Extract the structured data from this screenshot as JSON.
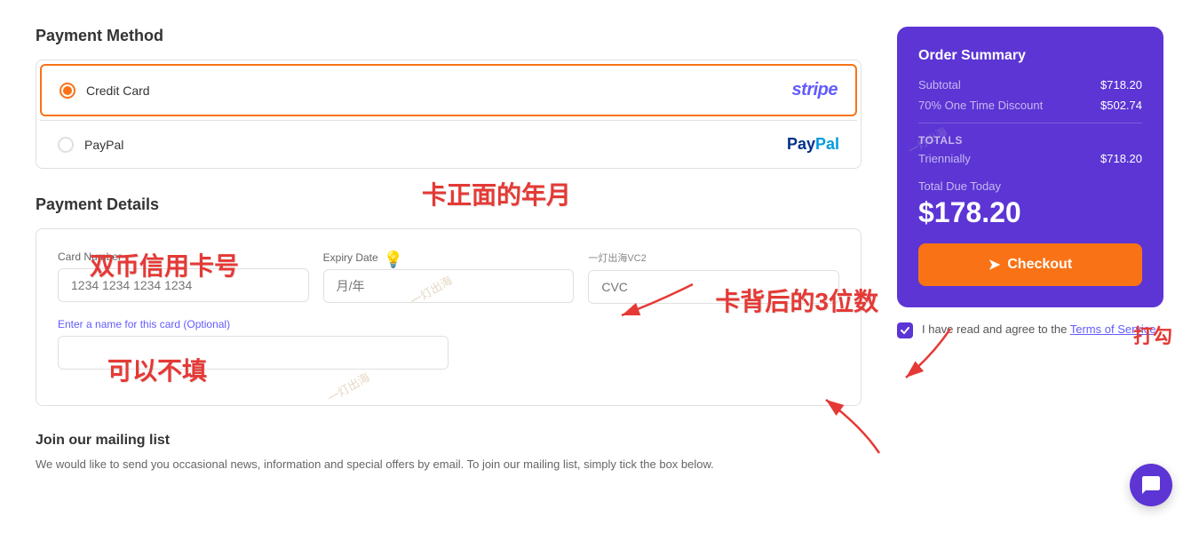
{
  "page": {
    "payment_method": {
      "title": "Payment Method",
      "options": [
        {
          "id": "credit-card",
          "label": "Credit Card",
          "selected": true,
          "logo": "stripe"
        },
        {
          "id": "paypal",
          "label": "PayPal",
          "selected": false,
          "logo": "paypal"
        }
      ]
    },
    "payment_details": {
      "title": "Payment Details",
      "fields": {
        "card_number": {
          "label": "Card Number",
          "placeholder": "1234 1234 1234 1234"
        },
        "expiry": {
          "label": "Expiry Date",
          "placeholder": "月/年"
        },
        "cvc": {
          "label": "CVC",
          "placeholder": "CVC"
        },
        "card_name": {
          "label": "Enter a name for this card (Optional)",
          "placeholder": ""
        }
      }
    },
    "mailing": {
      "title": "Join our mailing list",
      "description": "We would like to send you occasional news, information and special offers by email. To join our mailing list, simply tick the box below."
    },
    "annotations": {
      "card_number_cn": "双币信用卡号",
      "expiry_cn": "卡正面的年月",
      "cvc_cn": "卡背后的3位数",
      "optional_cn": "可以不填",
      "watermark": "一灯出海",
      "cvc_hint": "一灯出海VC2",
      "dagu": "打勾"
    },
    "order_summary": {
      "title": "Order Summary",
      "subtotal_label": "Subtotal",
      "subtotal_value": "$718.20",
      "discount_label": "70% One Time Discount",
      "discount_value": "$502.74",
      "totals_label": "Totals",
      "triennially_label": "Triennially",
      "triennially_value": "$718.20",
      "total_due_label": "Total Due Today",
      "total_due_amount": "$178.20",
      "checkout_label": "Checkout"
    },
    "terms": {
      "text_before": "I have read and agree to the ",
      "link_text": "Terms of Service",
      "text_after": ""
    }
  }
}
